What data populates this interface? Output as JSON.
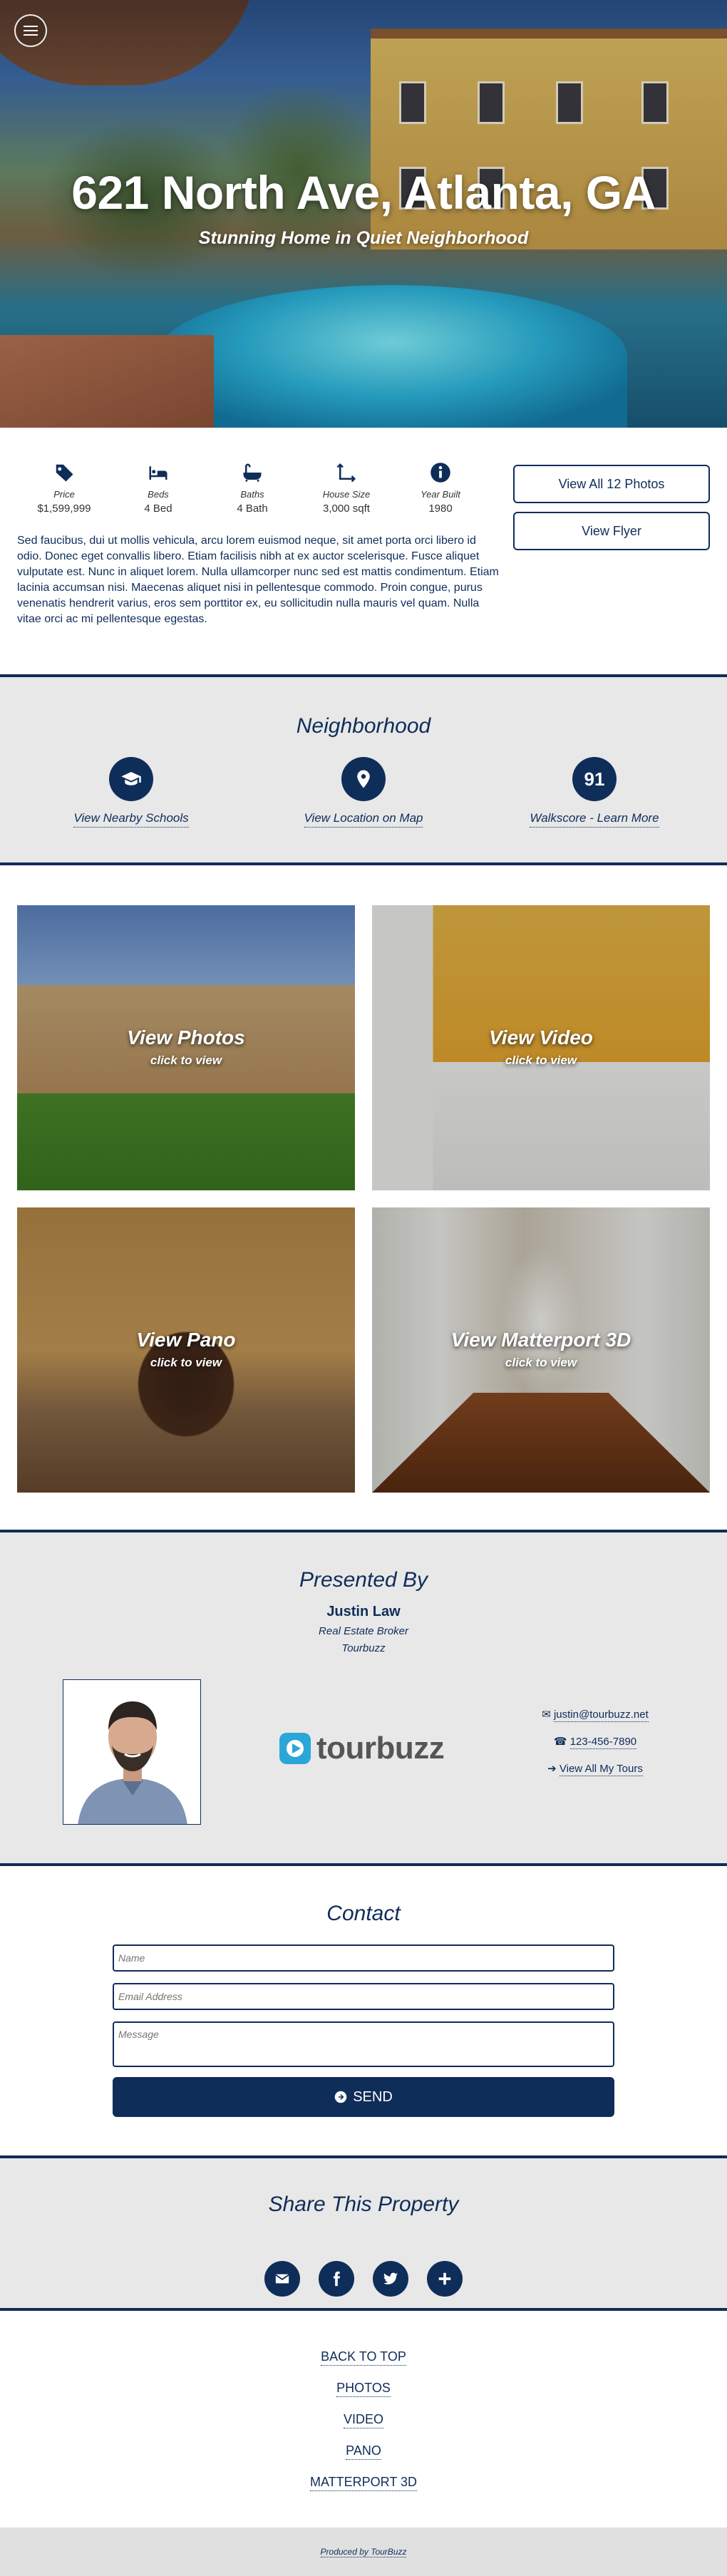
{
  "hero": {
    "title": "621 North Ave, Atlanta, GA",
    "subtitle": "Stunning Home in Quiet Neighborhood"
  },
  "stats": [
    {
      "icon": "price-tag-icon",
      "label": "Price",
      "value": "$1,599,999"
    },
    {
      "icon": "bed-icon",
      "label": "Beds",
      "value": "4 Bed"
    },
    {
      "icon": "bath-icon",
      "label": "Baths",
      "value": "4 Bath"
    },
    {
      "icon": "house-size-icon",
      "label": "House Size",
      "value": "3,000 sqft"
    },
    {
      "icon": "info-icon",
      "label": "Year Built",
      "value": "1980"
    }
  ],
  "buttons": {
    "all_photos": "View All 12 Photos",
    "flyer": "View Flyer"
  },
  "description": "Sed faucibus, dui ut mollis vehicula, arcu lorem euismod neque, sit amet porta orci libero id odio. Donec eget convallis libero. Etiam facilisis nibh at ex auctor scelerisque. Fusce aliquet vulputate est. Nunc in aliquet lorem. Nulla ullamcorper nunc sed est mattis condimentum. Etiam lacinia accumsan nisi. Maecenas aliquet nisi in pellentesque commodo. Proin congue, purus venenatis hendrerit varius, eros sem porttitor ex, eu sollicitudin nulla mauris vel quam. Nulla vitae orci ac mi pellentesque egestas.",
  "neighborhood": {
    "title": "Neighborhood",
    "schools": "View Nearby Schools",
    "map": "View Location on Map",
    "walkscore_value": "91",
    "walkscore": "Walkscore - Learn More"
  },
  "media": [
    {
      "title": "View Photos",
      "sub": "click to view"
    },
    {
      "title": "View Video",
      "sub": "click to view"
    },
    {
      "title": "View Pano",
      "sub": "click to view"
    },
    {
      "title": "View Matterport 3D",
      "sub": "click to view"
    }
  ],
  "presented": {
    "title": "Presented By",
    "name": "Justin Law",
    "role": "Real Estate Broker",
    "company": "Tourbuzz",
    "logo_text": "tourbuzz",
    "email": "justin@tourbuzz.net",
    "phone": "123-456-7890",
    "tours": "View All My Tours"
  },
  "contact": {
    "title": "Contact",
    "name_placeholder": "Name",
    "email_placeholder": "Email Address",
    "message_placeholder": "Message",
    "send": "SEND"
  },
  "share": {
    "title": "Share This Property"
  },
  "footer_nav": [
    "BACK TO TOP",
    "PHOTOS",
    "VIDEO",
    "PANO",
    "MATTERPORT 3D"
  ],
  "footer": "Produced by TourBuzz",
  "colors": {
    "brand": "#0f2d59",
    "panel": "#e8e8e8",
    "logo_accent": "#2aa7d8"
  }
}
